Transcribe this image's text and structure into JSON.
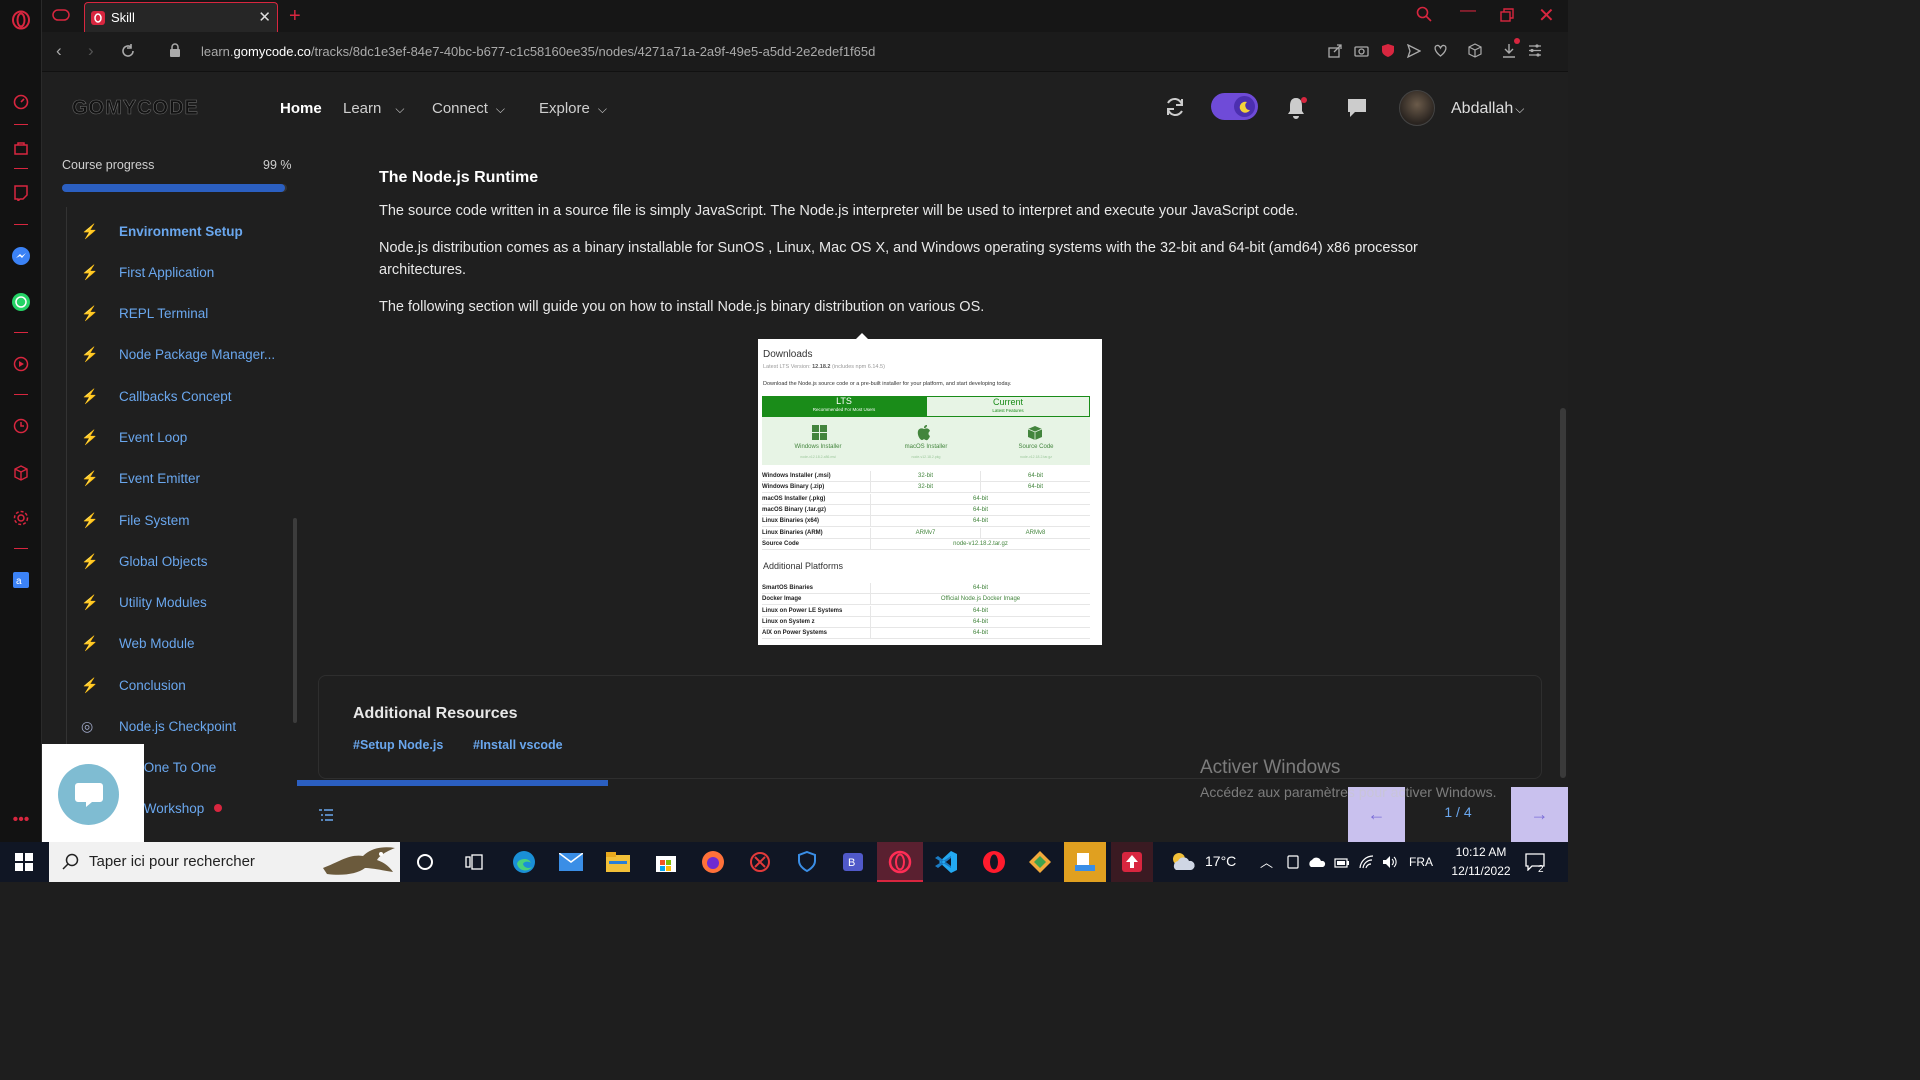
{
  "browser": {
    "tab_title": "Skill",
    "url_prefix": "learn.",
    "url_domain": "gomycode.co",
    "url_path": "/tracks/8dc1e3ef-84e7-40bc-b677-c1c58160ee35/nodes/4271a71a-2a9f-49e5-a5dd-2e2edef1f65d"
  },
  "header": {
    "logo": "GOMYCODE",
    "nav": [
      "Home",
      "Learn",
      "Connect",
      "Explore"
    ],
    "username": "Abdallah"
  },
  "sidebar": {
    "progress_label": "Course progress",
    "progress_value": "99 %",
    "progress_fraction": 0.99,
    "items": [
      {
        "label": "Environment Setup",
        "icon": "bolt-icon",
        "active": true
      },
      {
        "label": "First Application",
        "icon": "bolt-icon"
      },
      {
        "label": "REPL Terminal",
        "icon": "bolt-icon"
      },
      {
        "label": "Node Package Manager...",
        "icon": "bolt-icon"
      },
      {
        "label": "Callbacks Concept",
        "icon": "bolt-icon"
      },
      {
        "label": "Event Loop",
        "icon": "bolt-icon"
      },
      {
        "label": "Event Emitter",
        "icon": "bolt-icon"
      },
      {
        "label": "File System",
        "icon": "bolt-icon"
      },
      {
        "label": "Global Objects",
        "icon": "bolt-icon"
      },
      {
        "label": "Utility Modules",
        "icon": "bolt-icon"
      },
      {
        "label": "Web Module",
        "icon": "bolt-icon"
      },
      {
        "label": "Conclusion",
        "icon": "bolt-icon"
      },
      {
        "label": "Node.js Checkpoint",
        "icon": "target-icon"
      },
      {
        "label": "e.js One To One",
        "icon": ""
      },
      {
        "label": "e.js Workshop",
        "icon": ""
      }
    ]
  },
  "content": {
    "heading": "The Node.js Runtime",
    "p1": "The source code written in a source file is simply JavaScript. The Node.js interpreter will be used to interpret and execute your JavaScript code.",
    "p2a": "Node.js distribution comes as a binary installable for SunOS , Linux, Mac OS X, and Windows operating systems with the 32-bit and 64-bit (amd64) x86 processor",
    "p2b": "architectures.",
    "p3": "The following section will guide you on how to install Node.js binary distribution on various OS."
  },
  "download_image": {
    "title": "Downloads",
    "lts_prefix": "Latest LTS Version: ",
    "lts_version": "12.18.2",
    "lts_suffix": " (includes npm 6.14.5)",
    "intro": "Download the Node.js source code or a pre-built installer for your platform, and start developing today.",
    "tab_lts": "LTS",
    "tab_lts_sub": "Recommended For Most Users",
    "tab_current": "Current",
    "tab_current_sub": "Latest Features",
    "installers": [
      "Windows Installer",
      "macOS Installer",
      "Source Code"
    ],
    "installer_files": [
      "node-v12.18.2-x86.msi",
      "node-v12.18.2.pkg",
      "node-v12.18.2.tar.gz"
    ],
    "rows": [
      {
        "label": "Windows Installer (.msi)",
        "cells": [
          "32-bit",
          "64-bit"
        ]
      },
      {
        "label": "Windows Binary (.zip)",
        "cells": [
          "32-bit",
          "64-bit"
        ]
      },
      {
        "label": "macOS Installer (.pkg)",
        "cells": [
          "64-bit"
        ]
      },
      {
        "label": "macOS Binary (.tar.gz)",
        "cells": [
          "64-bit"
        ]
      },
      {
        "label": "Linux Binaries (x64)",
        "cells": [
          "64-bit"
        ]
      },
      {
        "label": "Linux Binaries (ARM)",
        "cells": [
          "ARMv7",
          "ARMv8"
        ]
      },
      {
        "label": "Source Code",
        "cells": [
          "node-v12.18.2.tar.gz"
        ]
      }
    ],
    "additional_title": "Additional Platforms",
    "additional_rows": [
      {
        "label": "SmartOS Binaries",
        "cells": [
          "64-bit"
        ]
      },
      {
        "label": "Docker Image",
        "cells": [
          "Official Node.js Docker Image"
        ]
      },
      {
        "label": "Linux on Power LE Systems",
        "cells": [
          "64-bit"
        ]
      },
      {
        "label": "Linux on System z",
        "cells": [
          "64-bit"
        ]
      },
      {
        "label": "AIX on Power Systems",
        "cells": [
          "64-bit"
        ]
      }
    ]
  },
  "resources": {
    "title": "Additional Resources",
    "links": [
      "#Setup Node.js",
      "#Install vscode"
    ]
  },
  "pager": {
    "label": "1 / 4",
    "progress_fraction": 0.25
  },
  "watermark": {
    "title": "Activer Windows",
    "sub": "Accédez aux paramètres pour activer Windows."
  },
  "taskbar": {
    "search_placeholder": "Taper ici pour rechercher",
    "weather": "17°C",
    "lang": "FRA",
    "time": "10:12 AM",
    "date": "12/11/2022",
    "notif_count": "2"
  },
  "colors": {
    "accent_red": "#d8263f",
    "link_blue": "#6aa7ee",
    "progress_blue": "#2b5fc1",
    "node_green": "#43853d"
  }
}
